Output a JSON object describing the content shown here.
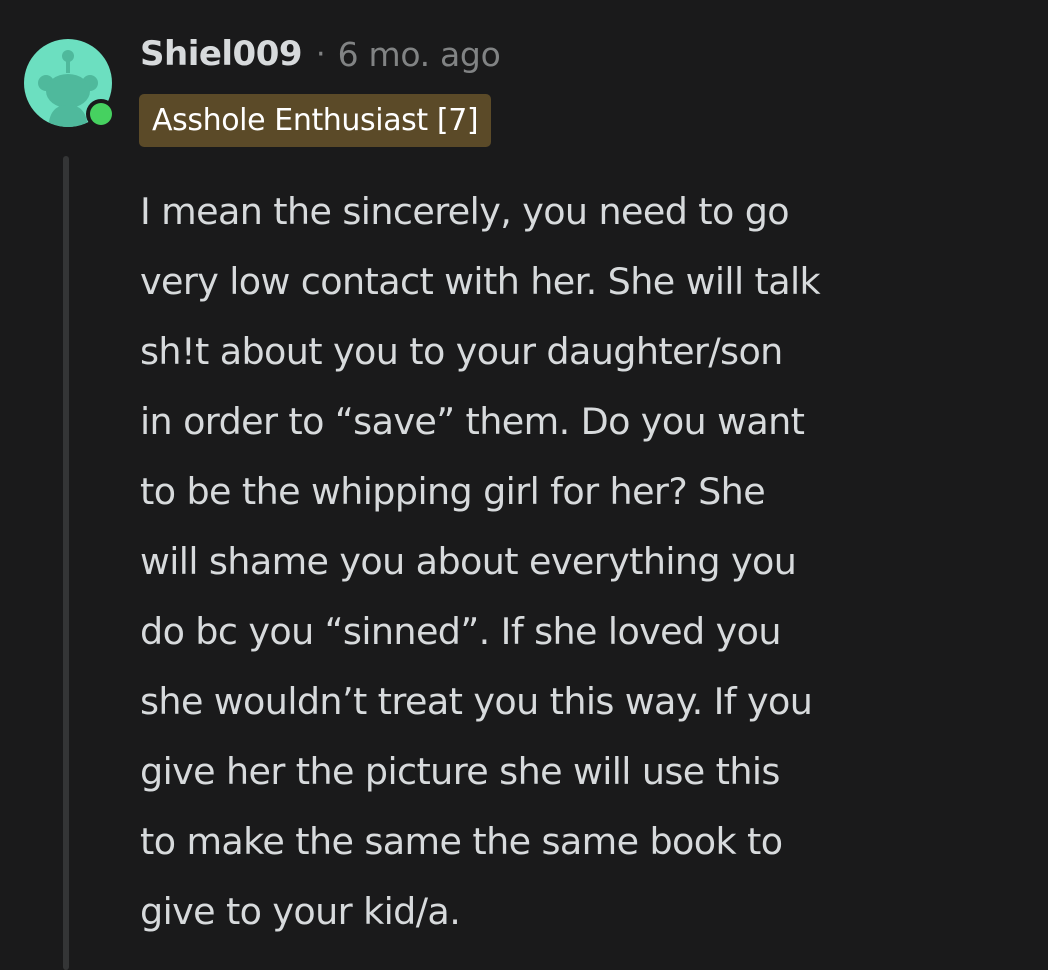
{
  "comment": {
    "username": "Shiel009",
    "separator": "·",
    "timestamp": "6 mo. ago",
    "flair": "Asshole Enthusiast [7]",
    "body_lines": [
      "I mean the sincerely, you need to go",
      "very low contact with her. She will talk",
      "sh!t about you to your daughter/son",
      "in order to “save” them. Do you want",
      "to be the whipping girl for her? She",
      "will shame you about everything you",
      "do bc you “sinned”. If she loved you",
      "she wouldn’t treat you this way. If you",
      "give her the picture she will use this",
      "to make the same the same book to",
      "give to your kid/a."
    ]
  },
  "colors": {
    "background": "#1a1a1b",
    "text_primary": "#d7dadc",
    "text_secondary": "#818384",
    "flair_bg": "#5b4a28",
    "avatar_bg": "#6cdfc0",
    "online_dot": "#46d160",
    "thread_line": "#343536"
  },
  "icons": {
    "avatar": "snoo-avatar-icon",
    "online_status": "online-status-dot-icon"
  }
}
